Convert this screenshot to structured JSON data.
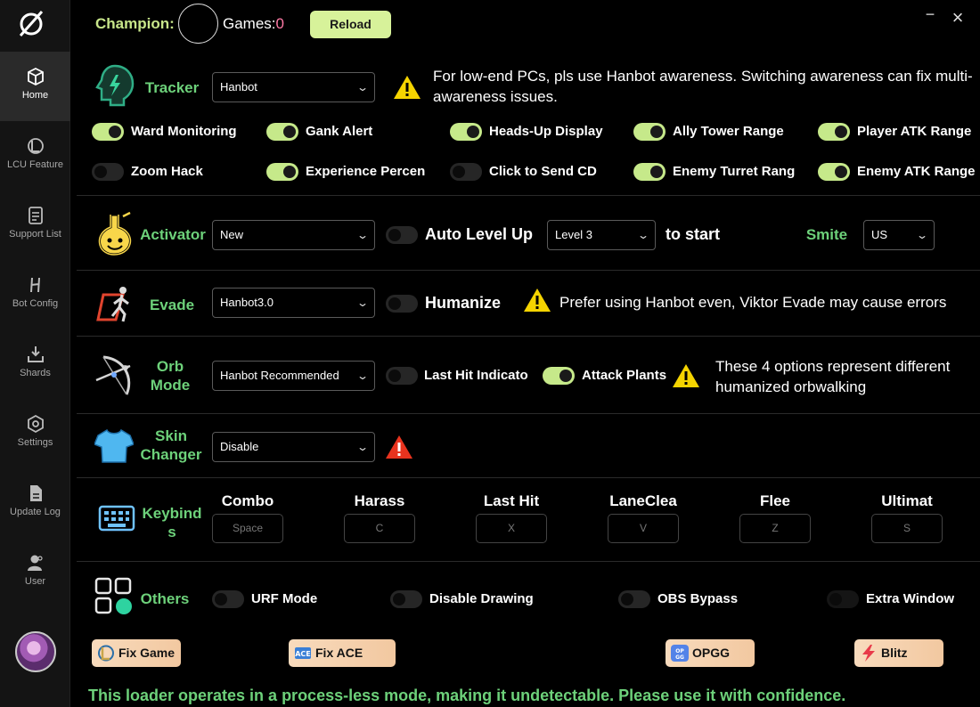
{
  "header": {
    "champion_label": "Champion:",
    "games_label": "Games:",
    "games_count": "0",
    "reload_label": "Reload",
    "minimize_glyph": "−",
    "close_glyph": "×"
  },
  "sidebar": {
    "items": [
      {
        "label": "Home",
        "icon": "cube-icon"
      },
      {
        "label": "LCU Feature",
        "icon": "lcu-icon"
      },
      {
        "label": "Support List",
        "icon": "list-icon"
      },
      {
        "label": "Bot Config",
        "icon": "hanbot-icon"
      },
      {
        "label": "Shards",
        "icon": "download-icon"
      },
      {
        "label": "Settings",
        "icon": "settings-icon"
      },
      {
        "label": "Update Log",
        "icon": "document-icon"
      },
      {
        "label": "User",
        "icon": "user-icon"
      }
    ]
  },
  "tracker": {
    "title": "Tracker",
    "select": "Hanbot",
    "note": "For low-end PCs, pls use Hanbot awareness. Switching awareness can fix multi-awareness issues.",
    "toggles": [
      {
        "label": "Ward Monitoring",
        "on": true
      },
      {
        "label": "Gank Alert",
        "on": true
      },
      {
        "label": "Heads-Up Display",
        "on": true
      },
      {
        "label": "Ally Tower Range",
        "on": true
      },
      {
        "label": "Player ATK Range",
        "on": true
      },
      {
        "label": "Zoom Hack",
        "on": false
      },
      {
        "label": "Experience Percen",
        "on": true
      },
      {
        "label": "Click to Send CD",
        "on": false
      },
      {
        "label": "Enemy Turret Rang",
        "on": true
      },
      {
        "label": "Enemy ATK Range",
        "on": true
      }
    ]
  },
  "activator": {
    "title": "Activator",
    "select": "New",
    "auto_level_label": "Auto Level Up",
    "auto_level_on": false,
    "level_select": "Level 3",
    "to_start": "to start",
    "smite_label": "Smite",
    "smite_select": "US"
  },
  "evade": {
    "title": "Evade",
    "select": "Hanbot3.0",
    "humanize_label": "Humanize",
    "humanize_on": false,
    "note": "Prefer using Hanbot even, Viktor Evade may cause errors"
  },
  "orb": {
    "title_line1": "Orb",
    "title_line2": "Mode",
    "select": "Hanbot Recommended",
    "last_hit_label": "Last Hit Indicato",
    "last_hit_on": false,
    "attack_plants_label": "Attack Plants",
    "attack_plants_on": true,
    "note": "These 4 options represent different humanized orbwalking"
  },
  "skin": {
    "title_line1": "Skin",
    "title_line2": "Changer",
    "select": "Disable"
  },
  "keybinds": {
    "title_line1": "Keybind",
    "title_line2": "s",
    "items": [
      {
        "label": "Combo",
        "key": "Space"
      },
      {
        "label": "Harass",
        "key": "C"
      },
      {
        "label": "Last Hit",
        "key": "X"
      },
      {
        "label": "LaneClea",
        "key": "V"
      },
      {
        "label": "Flee",
        "key": "Z"
      },
      {
        "label": "Ultimat",
        "key": "S"
      }
    ]
  },
  "others": {
    "title": "Others",
    "toggles": [
      {
        "label": "URF Mode",
        "on": false
      },
      {
        "label": "Disable Drawing",
        "on": false
      },
      {
        "label": "OBS Bypass",
        "on": false
      },
      {
        "label": "Extra Window",
        "on": false
      }
    ]
  },
  "buttons": {
    "fix_game": "Fix Game",
    "fix_ace": "Fix ACE",
    "opgg": "OPGG",
    "blitz": "Blitz"
  },
  "footer": "This loader operates in a process-less mode, making it undetectable. Please use it with confidence.",
  "colors": {
    "accent_green": "#6dd17a",
    "toggle_on": "#c6e98a",
    "reload_bg": "#d7f29a",
    "warning_yellow": "#f5d400",
    "warning_red": "#e8331e",
    "games_count": "#ff7aa6"
  }
}
